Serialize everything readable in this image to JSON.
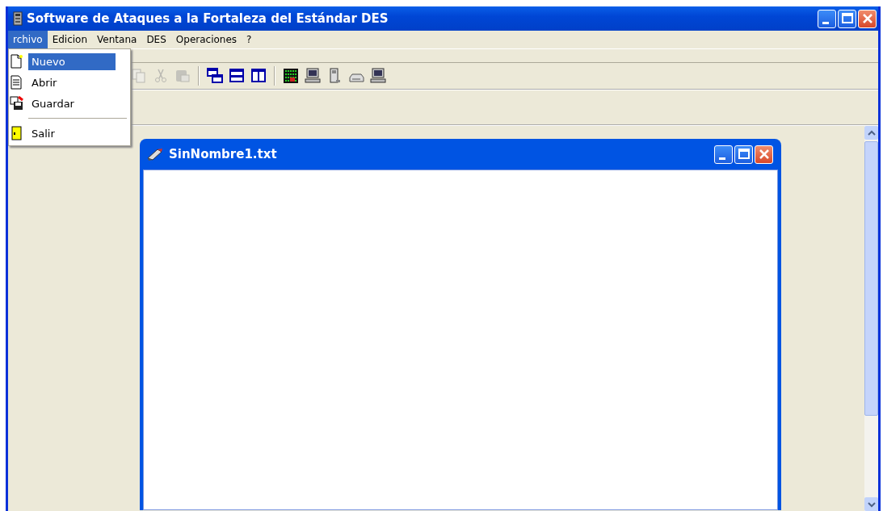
{
  "window": {
    "title": "Software de Ataques a la Fortaleza del Estándar DES"
  },
  "menu_bar": [
    {
      "label": "rchivo",
      "selected": true
    },
    {
      "label": "Edicion",
      "selected": false
    },
    {
      "label": "Ventana",
      "selected": false
    },
    {
      "label": "DES",
      "selected": false
    },
    {
      "label": "Operaciones",
      "selected": false
    },
    {
      "label": "?",
      "selected": false
    }
  ],
  "dropdown": [
    {
      "kind": "new",
      "label": "Nuevo",
      "selected": true
    },
    {
      "kind": "open",
      "label": "Abrir",
      "selected": false
    },
    {
      "kind": "save",
      "label": "Guardar",
      "selected": false
    },
    {
      "kind": "separator"
    },
    {
      "kind": "exit",
      "label": "Salir",
      "selected": false
    }
  ],
  "toolbar": [
    {
      "kind": "copy",
      "disabled": true
    },
    {
      "kind": "cut",
      "disabled": true
    },
    {
      "kind": "paste",
      "disabled": true
    },
    {
      "kind": "separator"
    },
    {
      "kind": "cascade",
      "disabled": false
    },
    {
      "kind": "tile-horizontal",
      "disabled": false
    },
    {
      "kind": "tile-vertical",
      "disabled": false
    },
    {
      "kind": "separator"
    },
    {
      "kind": "matrix",
      "disabled": false
    },
    {
      "kind": "computer",
      "disabled": false
    },
    {
      "kind": "tower",
      "disabled": false
    },
    {
      "kind": "drive",
      "disabled": false
    },
    {
      "kind": "computer",
      "disabled": false
    }
  ],
  "child_window": {
    "title": "SinNombre1.txt"
  }
}
